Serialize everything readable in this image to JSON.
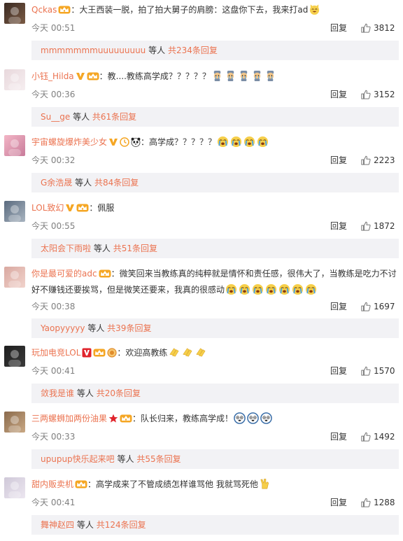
{
  "reply_label": "回复",
  "others_label": "等人",
  "comments": [
    {
      "username": "Qckas",
      "text": "：大王西装一脱，拍了拍大舅子的肩膀：这盘你下去，我来打ad",
      "time": "今天 00:51",
      "likes": "3812",
      "sub_user": "mmmmmmmuuuuuuuuu",
      "sub_count": "共234条回复",
      "badges": [
        "vip-crown-icon"
      ],
      "emojis": [
        "laughing-cat-emoji"
      ]
    },
    {
      "username": "小钰_Hilda",
      "text": "：教....教练高学成？？？？？",
      "time": "今天 00:36",
      "likes": "3152",
      "sub_user": "Su__ge",
      "sub_count": "共61条回复",
      "badges": [
        "verified-v-icon",
        "vip-crown-icon"
      ],
      "emojis": [
        "crying-doll-emoji",
        "crying-doll-emoji",
        "crying-doll-emoji",
        "crying-doll-emoji",
        "crying-doll-emoji"
      ]
    },
    {
      "username": "宇宙螺旋爆炸美少女",
      "text": "：高学成？？？？？",
      "time": "今天 00:32",
      "likes": "2223",
      "sub_user": "G余浩晟",
      "sub_count": "共84条回复",
      "badges": [
        "verified-v-icon",
        "clock-badge-icon",
        "panda-badge-icon"
      ],
      "emojis": [
        "crying-face-emoji",
        "crying-face-emoji",
        "crying-face-emoji",
        "crying-face-emoji"
      ]
    },
    {
      "username": "LOL致幻",
      "text": "：佩服",
      "time": "今天 00:55",
      "likes": "1872",
      "sub_user": "太阳会下雨啦",
      "sub_count": "共51条回复",
      "badges": [
        "verified-v-icon",
        "vip-crown-icon"
      ],
      "emojis": []
    },
    {
      "username": "你是最可爱的adc",
      "text": "：微笑回来当教练真的纯粹就是情怀和责任感，很伟大了，当教练是吃力不讨好不赚钱还要挨骂，但是微笑还要来，我真的很感动",
      "time": "今天 00:38",
      "likes": "1697",
      "sub_user": "Yaopyyyyy",
      "sub_count": "共39条回复",
      "badges": [
        "vip-crown-icon"
      ],
      "emojis": [
        "crying-face-emoji",
        "crying-face-emoji",
        "crying-face-emoji",
        "crying-face-emoji",
        "crying-face-emoji",
        "crying-face-emoji",
        "crying-face-emoji"
      ]
    },
    {
      "username": "玩加电竞LOL",
      "text": "：欢迎高教练",
      "time": "今天 00:41",
      "likes": "1570",
      "sub_user": "敛我是谁",
      "sub_count": "共20条回复",
      "badges": [
        "verified-v-red-icon",
        "vip-crown-icon",
        "medal-badge-icon"
      ],
      "emojis": [
        "clapping-emoji",
        "clapping-emoji",
        "clapping-emoji"
      ]
    },
    {
      "username": "三两螺蛳加两份油果",
      "text": "：队长归来，教练高学成！",
      "time": "今天 00:33",
      "likes": "1492",
      "sub_user": "upupup快乐起来吧",
      "sub_count": "共55条回复",
      "badges": [
        "star-badge-icon",
        "vip-crown-icon"
      ],
      "emojis": [
        "doge-emoji",
        "doge-emoji",
        "doge-emoji"
      ]
    },
    {
      "username": "甜内贩卖机",
      "text": "：高学成来了不管成绩怎样谁骂他 我就骂死他",
      "time": "今天 00:41",
      "likes": "1288",
      "sub_user": "舞神赵四",
      "sub_count": "共124条回复",
      "badges": [
        "vip-crown-icon"
      ],
      "emojis": [
        "victory-hand-emoji"
      ]
    }
  ],
  "colors": {
    "username": "#eb7350",
    "text": "#333333",
    "meta": "#808080",
    "subbox_bg": "#f2f2f5",
    "vip": "#f5a623"
  }
}
